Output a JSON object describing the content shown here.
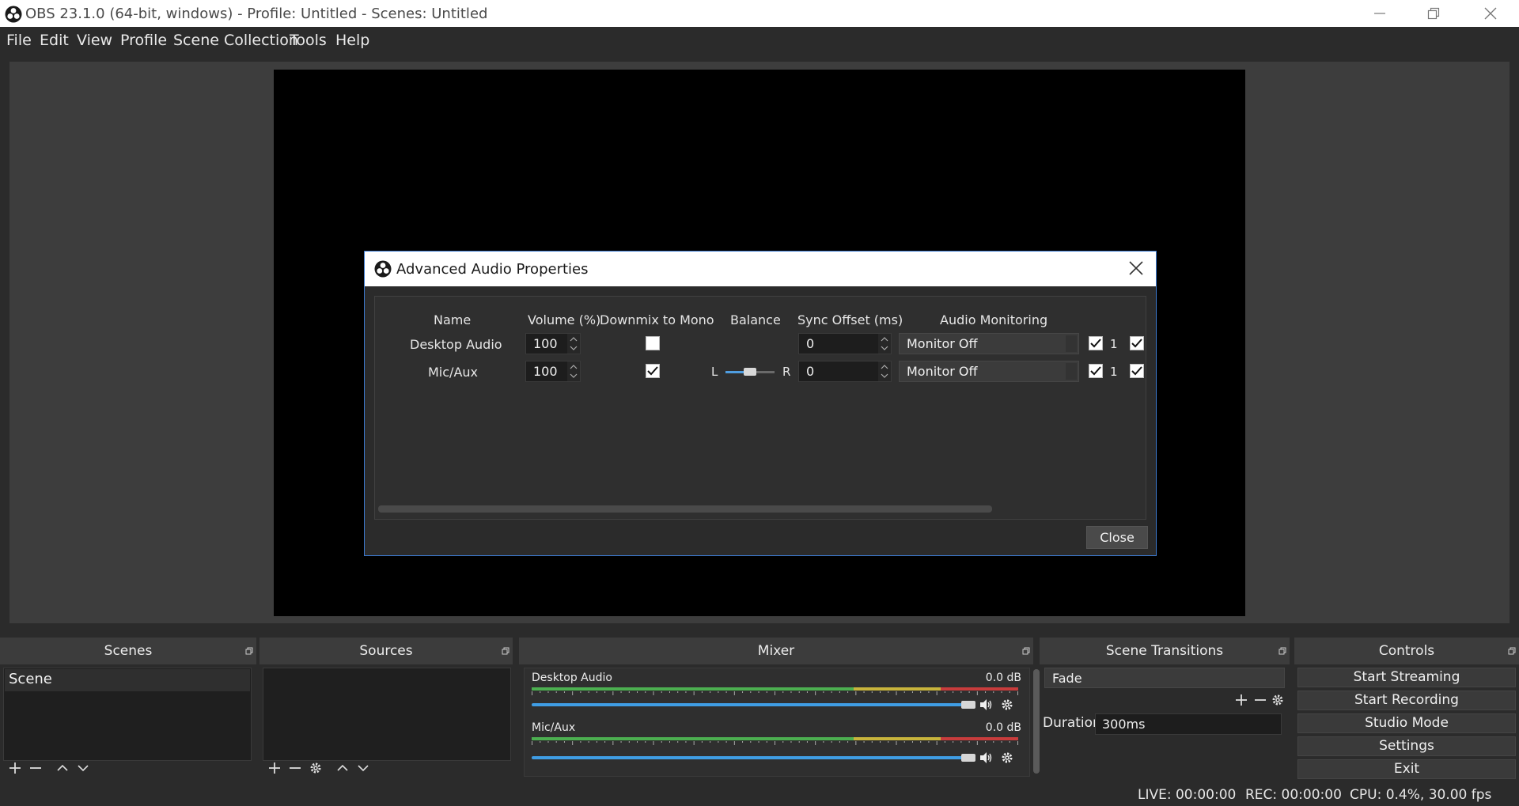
{
  "window": {
    "title": "OBS 23.1.0 (64-bit, windows) - Profile: Untitled - Scenes: Untitled"
  },
  "menu": [
    "File",
    "Edit",
    "View",
    "Profile",
    "Scene Collection",
    "Tools",
    "Help"
  ],
  "dialog": {
    "title": "Advanced Audio Properties",
    "columns": {
      "name": "Name",
      "volume": "Volume (%)",
      "downmix": "Downmix to Mono",
      "balance": "Balance",
      "sync": "Sync Offset (ms)",
      "monitoring": "Audio Monitoring"
    },
    "rows": [
      {
        "name": "Desktop Audio",
        "volume": "100",
        "downmix": false,
        "sync": "0",
        "monitoring": "Monitor Off",
        "track1_label": "1",
        "track1": true,
        "track2": true
      },
      {
        "name": "Mic/Aux",
        "volume": "100",
        "downmix": true,
        "balance_left": "L",
        "balance_right": "R",
        "balance": 0.5,
        "sync": "0",
        "monitoring": "Monitor Off",
        "track1_label": "1",
        "track1": true,
        "track2": true
      }
    ],
    "close_button": "Close"
  },
  "docks": {
    "scenes": {
      "title": "Scenes",
      "items": [
        "Scene"
      ]
    },
    "sources": {
      "title": "Sources",
      "items": []
    },
    "mixer": {
      "title": "Mixer",
      "channels": [
        {
          "name": "Desktop Audio",
          "db": "0.0 dB",
          "volume": 1.0
        },
        {
          "name": "Mic/Aux",
          "db": "0.0 dB",
          "volume": 1.0
        }
      ],
      "meter_ticks": [
        "-60",
        "-55",
        "-50",
        "-45",
        "-40",
        "-35",
        "-30",
        "-25",
        "-20",
        "-15",
        "-10",
        "-5",
        "0"
      ]
    },
    "transitions": {
      "title": "Scene Transitions",
      "selected": "Fade",
      "duration_label": "Duration",
      "duration": "300ms"
    },
    "controls": {
      "title": "Controls",
      "buttons": [
        "Start Streaming",
        "Start Recording",
        "Studio Mode",
        "Settings",
        "Exit"
      ]
    }
  },
  "status": {
    "live": "LIVE: 00:00:00",
    "rec": "REC: 00:00:00",
    "cpu": "CPU: 0.4%, 30.00 fps"
  },
  "colors": {
    "accent": "#3c7ad0",
    "meter_green": "#4caf50",
    "meter_yellow": "#c8b43c",
    "meter_red": "#c83c3c",
    "slider_blue": "#3f9de4"
  }
}
